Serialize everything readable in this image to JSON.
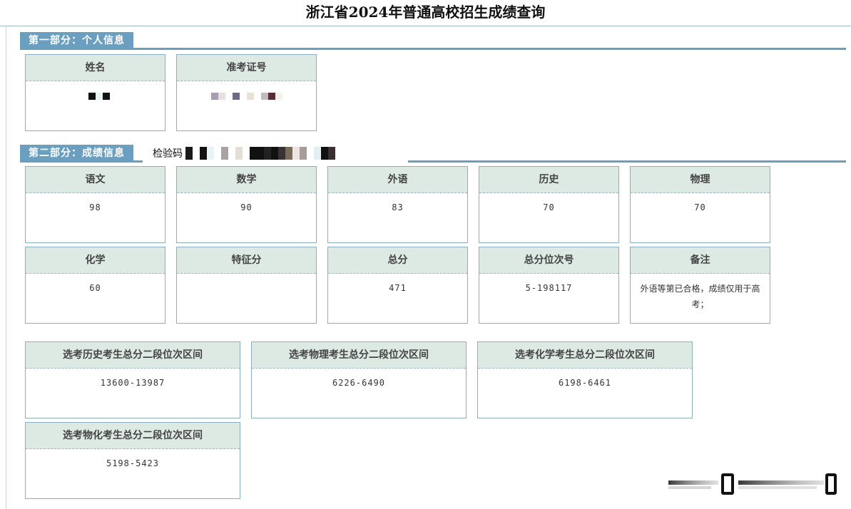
{
  "page": {
    "title": "浙江省2024年普通高校招生成绩查询"
  },
  "section1": {
    "label": "第一部分：个人信息",
    "fields": [
      {
        "name": "姓名",
        "value": ""
      },
      {
        "name": "准考证号",
        "value": ""
      }
    ]
  },
  "section2": {
    "label": "第二部分：成绩信息",
    "check_code_label": "检验码",
    "scores": [
      {
        "name": "语文",
        "value": "98"
      },
      {
        "name": "数学",
        "value": "90"
      },
      {
        "name": "外语",
        "value": "83"
      },
      {
        "name": "历史",
        "value": "70"
      },
      {
        "name": "物理",
        "value": "70"
      },
      {
        "name": "化学",
        "value": "60"
      },
      {
        "name": "特征分",
        "value": ""
      },
      {
        "name": "总分",
        "value": "471"
      },
      {
        "name": "总分位次号",
        "value": "5-198117"
      },
      {
        "name": "备注",
        "value": "外语等第已合格，成绩仅用于高考；"
      }
    ],
    "ranges": [
      {
        "name": "选考历史考生总分二段位次区间",
        "value": "13600-13987"
      },
      {
        "name": "选考物理考生总分二段位次区间",
        "value": "6226-6490"
      },
      {
        "name": "选考化学考生总分二段位次区间",
        "value": "6198-6461"
      },
      {
        "name": "选考物化考生总分二段位次区间",
        "value": "5198-5423"
      }
    ]
  },
  "colors": {
    "section_bar": "#6a9fc0",
    "card_header_bg": "#dde9e3",
    "card_border": "#8aaec4"
  }
}
